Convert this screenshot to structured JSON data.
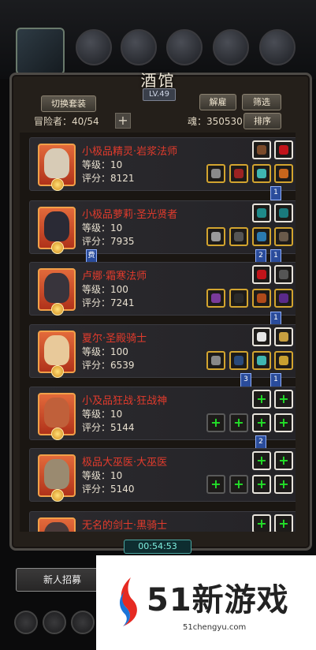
{
  "header": {
    "title": "酒馆",
    "level": "LV.49",
    "switch_label": "切换套装",
    "dismiss_label": "解雇",
    "filter_label": "筛选",
    "adventurers_text": "冒险者：40/54",
    "plus_label": "+",
    "soul_text": "魂：350530",
    "sort_label": "排序"
  },
  "heroes": [
    {
      "name": "小极品精灵·岩浆法师",
      "level": "等级：10",
      "score": "评分：8121"
    },
    {
      "name": "小极品萝莉·圣光贤者",
      "level": "等级：10",
      "score": "评分：7935"
    },
    {
      "name": "卢娜·霜寒法师",
      "level": "等级：100",
      "score": "评分：7241"
    },
    {
      "name": "夏尔·圣殿骑士",
      "level": "等级：100",
      "score": "评分：6539"
    },
    {
      "name": "小及品狂战·狂战神",
      "level": "等级：10",
      "score": "评分：5144"
    },
    {
      "name": "极品大巫医·大巫医",
      "level": "等级：10",
      "score": "评分：5140"
    },
    {
      "name": "无名的剑士·黑骑士",
      "level": "",
      "score": ""
    }
  ],
  "flags": {
    "f1": "1",
    "f2": "2",
    "f3": "1",
    "f4": "1",
    "f5": "3",
    "f6": "1",
    "f7": "2",
    "side": "费"
  },
  "slot_plus": "+",
  "timer": "00:54:53",
  "bottom": {
    "recruit_label": "新人招募"
  },
  "watermark": {
    "brand": "51新游戏",
    "url": "51chengyu.com"
  },
  "colors": {
    "hero_name": "#e23b2c",
    "plus_green": "#22e028",
    "gold_frame": "#d2a42f",
    "flag_blue": "#2a4c9b"
  }
}
